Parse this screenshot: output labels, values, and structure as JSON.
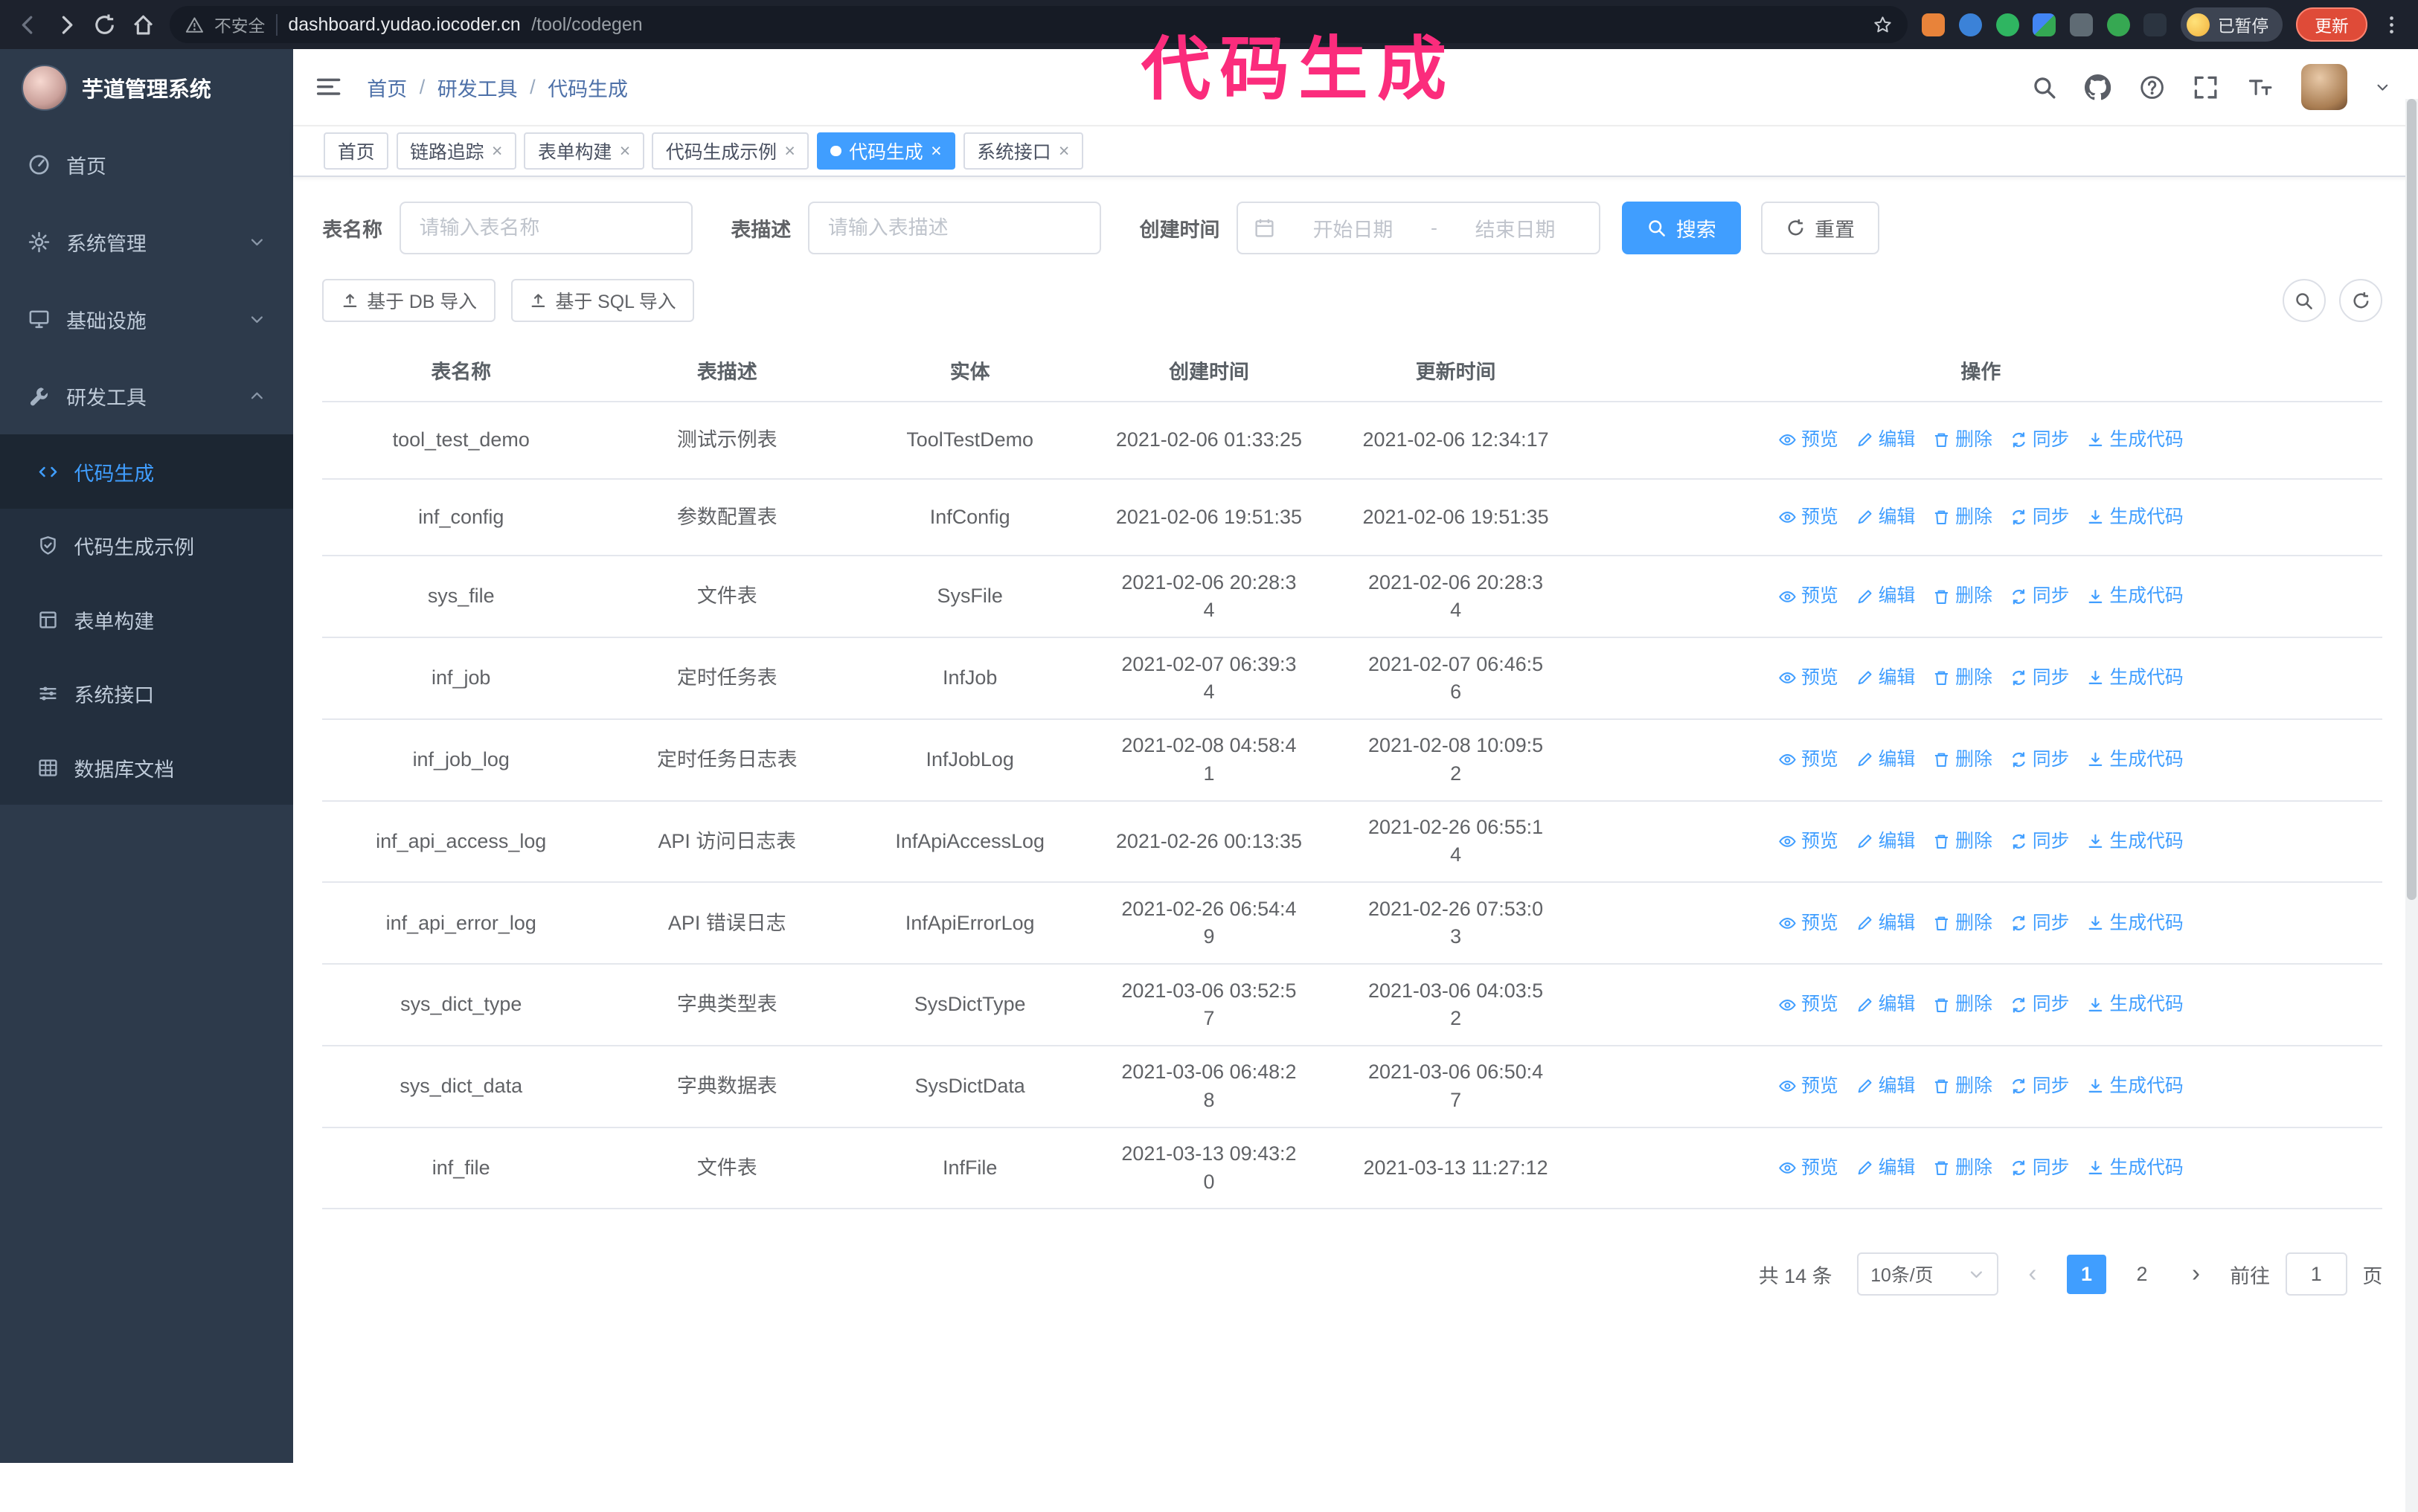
{
  "browser": {
    "security_label": "不安全",
    "url_host": "dashboard.yudao.iocoder.cn",
    "url_path": "/tool/codegen",
    "paused_badge": "已暂停",
    "update_button": "更新"
  },
  "annotation": {
    "title": "代码生成",
    "color": "#fb2c7c"
  },
  "sidebar": {
    "logo_title": "芋道管理系统",
    "items": [
      {
        "label": "首页"
      },
      {
        "label": "系统管理"
      },
      {
        "label": "基础设施"
      },
      {
        "label": "研发工具"
      }
    ],
    "sub_items": [
      {
        "label": "代码生成"
      },
      {
        "label": "代码生成示例"
      },
      {
        "label": "表单构建"
      },
      {
        "label": "系统接口"
      },
      {
        "label": "数据库文档"
      }
    ]
  },
  "header": {
    "breadcrumb": [
      "首页",
      "研发工具",
      "代码生成"
    ],
    "separator": "/"
  },
  "tabs": [
    {
      "label": "首页"
    },
    {
      "label": "链路追踪"
    },
    {
      "label": "表单构建"
    },
    {
      "label": "代码生成示例"
    },
    {
      "label": "代码生成"
    },
    {
      "label": "系统接口"
    }
  ],
  "filters": {
    "table_name_label": "表名称",
    "table_name_placeholder": "请输入表名称",
    "table_desc_label": "表描述",
    "table_desc_placeholder": "请输入表描述",
    "create_time_label": "创建时间",
    "date_start_placeholder": "开始日期",
    "date_separator": "-",
    "date_end_placeholder": "结束日期",
    "search_button": "搜索",
    "reset_button": "重置"
  },
  "toolbar": {
    "import_db": "基于 DB 导入",
    "import_sql": "基于 SQL 导入"
  },
  "table": {
    "columns": [
      "表名称",
      "表描述",
      "实体",
      "创建时间",
      "更新时间",
      "操作"
    ],
    "actions": [
      "预览",
      "编辑",
      "删除",
      "同步",
      "生成代码"
    ],
    "rows": [
      {
        "name": "tool_test_demo",
        "desc": "测试示例表",
        "entity": "ToolTestDemo",
        "created": "2021-02-06 01:33:25",
        "updated": "2021-02-06 12:34:17"
      },
      {
        "name": "inf_config",
        "desc": "参数配置表",
        "entity": "InfConfig",
        "created": "2021-02-06 19:51:35",
        "updated": "2021-02-06 19:51:35"
      },
      {
        "name": "sys_file",
        "desc": "文件表",
        "entity": "SysFile",
        "created": "2021-02-06 20:28:3\n4",
        "updated": "2021-02-06 20:28:3\n4"
      },
      {
        "name": "inf_job",
        "desc": "定时任务表",
        "entity": "InfJob",
        "created": "2021-02-07 06:39:3\n4",
        "updated": "2021-02-07 06:46:5\n6"
      },
      {
        "name": "inf_job_log",
        "desc": "定时任务日志表",
        "entity": "InfJobLog",
        "created": "2021-02-08 04:58:4\n1",
        "updated": "2021-02-08 10:09:5\n2"
      },
      {
        "name": "inf_api_access_log",
        "desc": "API 访问日志表",
        "entity": "InfApiAccessLog",
        "created": "2021-02-26 00:13:35",
        "updated": "2021-02-26 06:55:1\n4"
      },
      {
        "name": "inf_api_error_log",
        "desc": "API 错误日志",
        "entity": "InfApiErrorLog",
        "created": "2021-02-26 06:54:4\n9",
        "updated": "2021-02-26 07:53:0\n3"
      },
      {
        "name": "sys_dict_type",
        "desc": "字典类型表",
        "entity": "SysDictType",
        "created": "2021-03-06 03:52:5\n7",
        "updated": "2021-03-06 04:03:5\n2"
      },
      {
        "name": "sys_dict_data",
        "desc": "字典数据表",
        "entity": "SysDictData",
        "created": "2021-03-06 06:48:2\n8",
        "updated": "2021-03-06 06:50:4\n7"
      },
      {
        "name": "inf_file",
        "desc": "文件表",
        "entity": "InfFile",
        "created": "2021-03-13 09:43:2\n0",
        "updated": "2021-03-13 11:27:12"
      }
    ]
  },
  "pagination": {
    "total": "共 14 条",
    "page_size": "10条/页",
    "page_1": "1",
    "page_2": "2",
    "goto_label": "前往",
    "goto_value": "1",
    "page_unit": "页"
  }
}
